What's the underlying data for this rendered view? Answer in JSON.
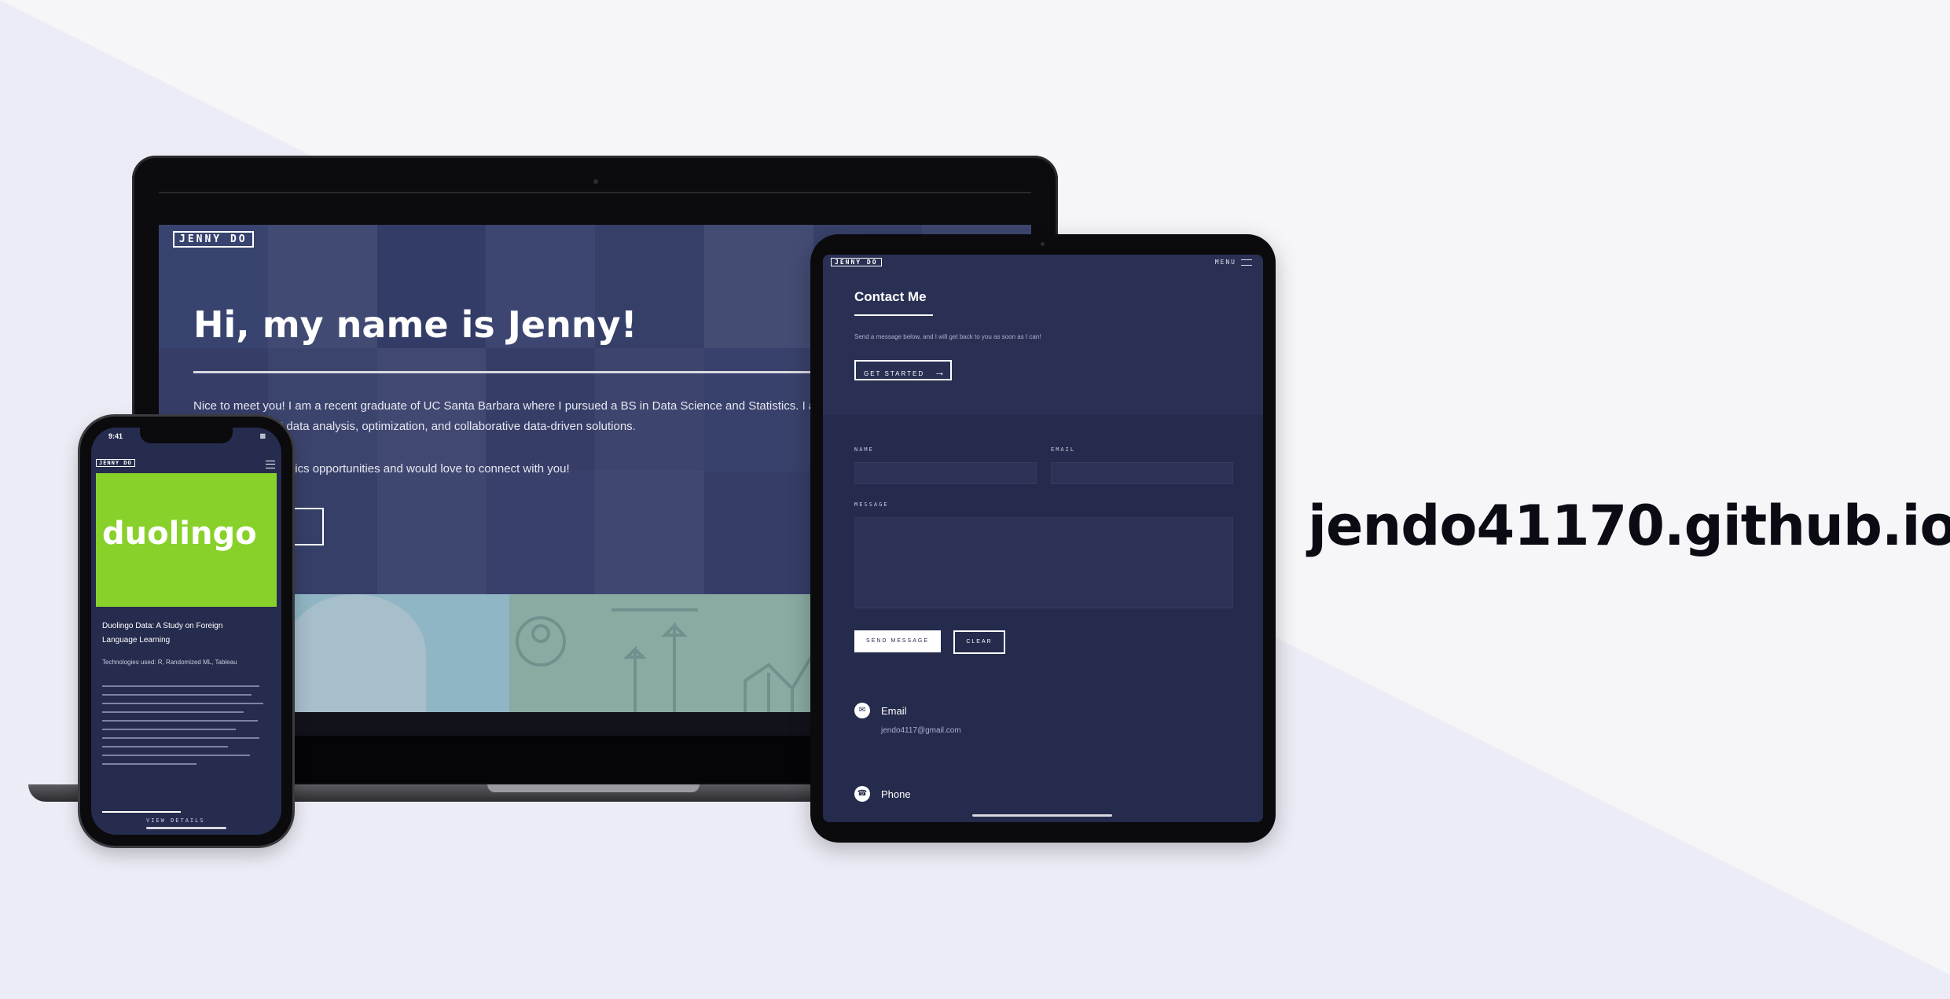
{
  "colors": {
    "page_background": "#f6f6f9",
    "accent_navy": "#252b4c",
    "highlight_green": "#88d12a"
  },
  "headline": {
    "site_url": "jendo41170.github.io"
  },
  "laptop": {
    "logo": "JENNY DO",
    "hero_title": "Hi, my name is Jenny!",
    "hero_intro": "Nice to meet you! I am a recent graduate of UC Santa Barbara where I pursued a BS in Data Science and Statistics. I am passionate about data analysis, optimization, and collaborative data-driven solutions.",
    "hero_contact_line": "I am seeking analytics opportunities and would love to connect with you!",
    "hero_button_icon": "arrow-right-icon"
  },
  "tablet": {
    "logo": "JENNY DO",
    "menu_label": "MENU",
    "section_title": "Contact Me",
    "section_desc": "Send a message below, and I will get back to you as soon as I can!",
    "get_started_label": "GET STARTED",
    "form": {
      "name_label": "NAME",
      "email_label": "EMAIL",
      "message_label": "MESSAGE",
      "send_label": "SEND MESSAGE",
      "clear_label": "CLEAR"
    },
    "info": {
      "email_label": "Email",
      "email_value": "jendo4117@gmail.com",
      "phone_label": "Phone"
    }
  },
  "phone": {
    "status_time": "9:41",
    "logo": "JENNY DO",
    "project_image_word": "duolingo",
    "project_title": "Duolingo Data: A Study on Foreign Language Learning",
    "project_meta": "Technologies used: R, Randomized ML, Tableau",
    "bottom_label": "VIEW DETAILS"
  }
}
